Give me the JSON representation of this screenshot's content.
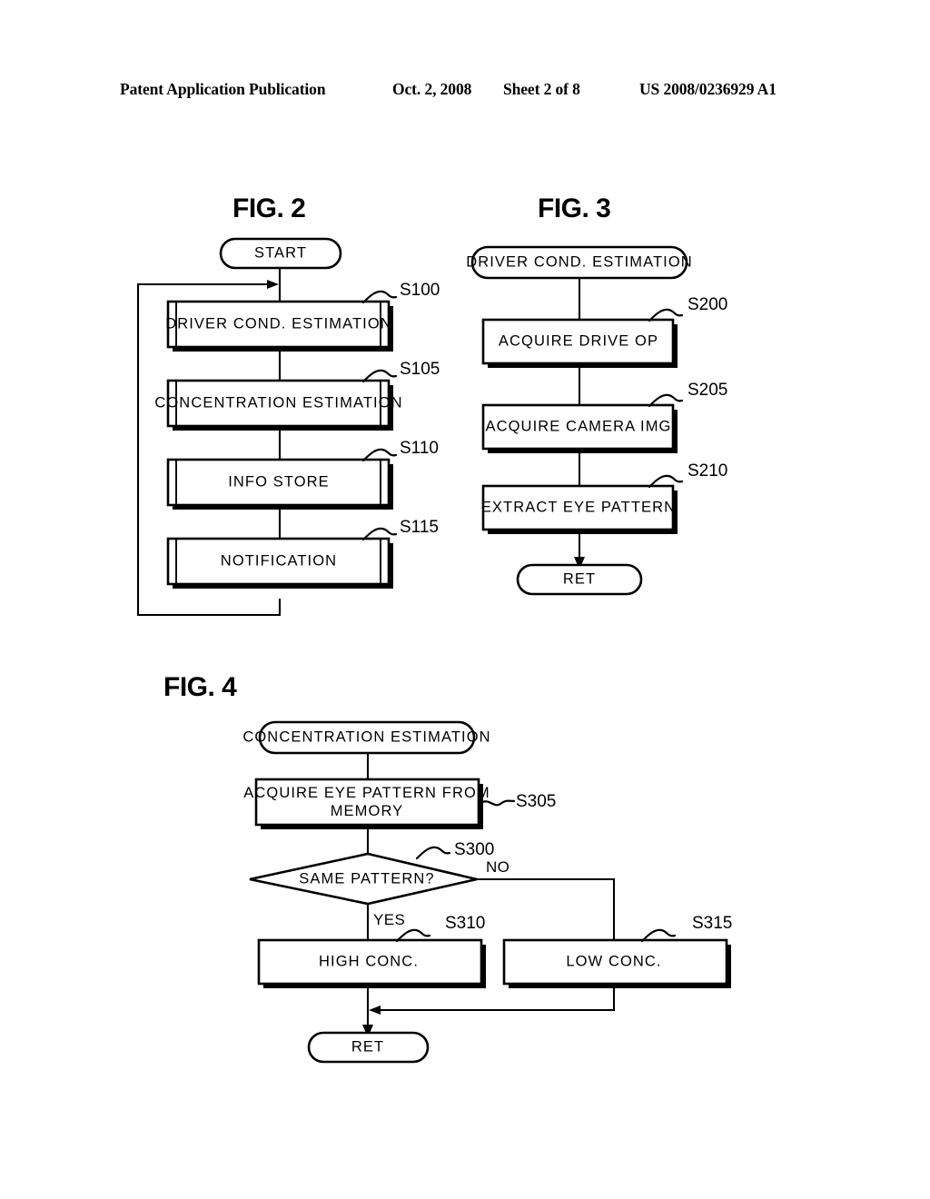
{
  "header": {
    "publication": "Patent Application Publication",
    "date": "Oct. 2, 2008",
    "sheet": "Sheet 2 of 8",
    "number": "US 2008/0236929 A1"
  },
  "figures": [
    {
      "id": "fig2",
      "title": "FIG. 2",
      "nodes": {
        "start": "START",
        "s100": "DRIVER COND.  ESTIMATION",
        "s105": "CONCENTRATION ESTIMATION",
        "s110": "INFO STORE",
        "s115": "NOTIFICATION"
      },
      "step_labels": {
        "s100": "S100",
        "s105": "S105",
        "s110": "S110",
        "s115": "S115"
      }
    },
    {
      "id": "fig3",
      "title": "FIG. 3",
      "nodes": {
        "entry": "DRIVER COND.  ESTIMATION",
        "s200": "ACQUIRE DRIVE OP",
        "s205": "ACQUIRE CAMERA IMG",
        "s210": "EXTRACT EYE PATTERN",
        "ret": "RET"
      },
      "step_labels": {
        "s200": "S200",
        "s205": "S205",
        "s210": "S210"
      }
    },
    {
      "id": "fig4",
      "title": "FIG. 4",
      "nodes": {
        "entry": "CONCENTRATION ESTIMATION",
        "s300_line1": "ACQUIRE EYE PATTERN FROM",
        "s300_line2": "MEMORY",
        "s305": "SAME PATTERN?",
        "s310": "HIGH CONC.",
        "s315": "LOW CONC.",
        "ret": "RET"
      },
      "step_labels": {
        "s300": "S300",
        "s305": "S305",
        "s310": "S310",
        "s315": "S315"
      },
      "branch_labels": {
        "yes": "YES",
        "no": "NO"
      }
    }
  ],
  "colors": {
    "ink": "#000000",
    "paper": "#ffffff"
  }
}
